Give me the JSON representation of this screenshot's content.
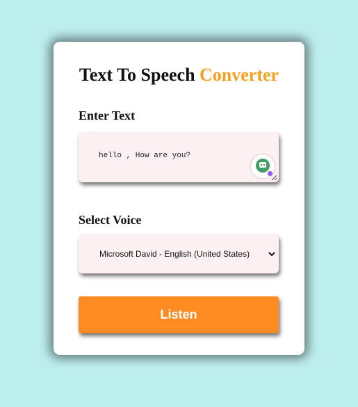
{
  "header": {
    "title_main": "Text To Speech ",
    "title_accent": "Converter"
  },
  "text_section": {
    "label": "Enter Text",
    "value": "hello , How are you?"
  },
  "voice_section": {
    "label": "Select Voice",
    "selected": "Microsoft David - English (United States)"
  },
  "actions": {
    "listen_label": "Listen"
  },
  "colors": {
    "page_background": "#bdeeee",
    "accent": "#f4a021",
    "button": "#ff8c22",
    "field_background": "#fdf0f2"
  },
  "icons": {
    "extension": "grammarly-icon",
    "resize": "resize-handle-icon",
    "dropdown": "chevron-down-icon"
  }
}
